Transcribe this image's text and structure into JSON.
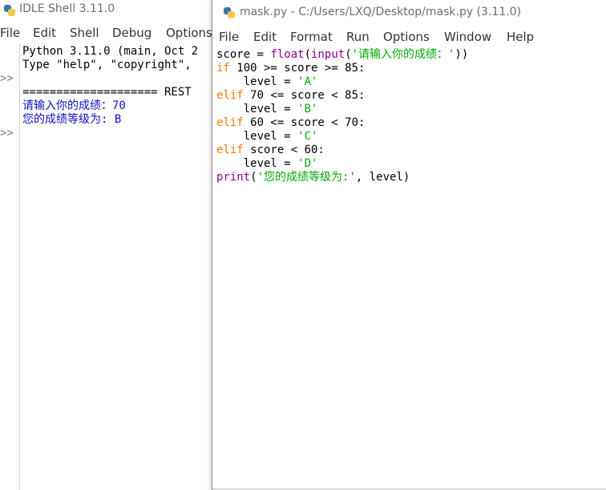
{
  "shell": {
    "title": "IDLE Shell 3.11.0",
    "menu": [
      "File",
      "Edit",
      "Shell",
      "Debug",
      "Options"
    ],
    "prompt": ">>",
    "lines": [
      {
        "text": "Python 3.11.0 (main, Oct 2",
        "cls": ""
      },
      {
        "text": "Type \"help\", \"copyright\",",
        "cls": ""
      },
      {
        "text": "",
        "cls": ""
      },
      {
        "text": "==================== REST",
        "cls": ""
      },
      {
        "text": "请输入你的成绩：70",
        "cls": "blue-out"
      },
      {
        "text": "您的成绩等级为: B",
        "cls": "blue-out"
      }
    ]
  },
  "editor": {
    "title": "mask.py - C:/Users/LXQ/Desktop/mask.py (3.11.0)",
    "menu": [
      "File",
      "Edit",
      "Format",
      "Run",
      "Options",
      "Window",
      "Help"
    ],
    "code": [
      [
        {
          "t": "score = ",
          "c": ""
        },
        {
          "t": "float",
          "c": "bi"
        },
        {
          "t": "(",
          "c": ""
        },
        {
          "t": "input",
          "c": "bi"
        },
        {
          "t": "(",
          "c": ""
        },
        {
          "t": "'请输入你的成绩：'",
          "c": "st"
        },
        {
          "t": "))",
          "c": ""
        }
      ],
      [
        {
          "t": "if",
          "c": "kw"
        },
        {
          "t": " 100 >= score >= 85:",
          "c": ""
        }
      ],
      [
        {
          "t": "    level = ",
          "c": ""
        },
        {
          "t": "'A'",
          "c": "st"
        }
      ],
      [
        {
          "t": "elif",
          "c": "kw"
        },
        {
          "t": " 70 <= score < 85:",
          "c": ""
        }
      ],
      [
        {
          "t": "    level = ",
          "c": ""
        },
        {
          "t": "'B'",
          "c": "st"
        }
      ],
      [
        {
          "t": "elif",
          "c": "kw"
        },
        {
          "t": " 60 <= score < 70:",
          "c": ""
        }
      ],
      [
        {
          "t": "    level = ",
          "c": ""
        },
        {
          "t": "'C'",
          "c": "st"
        }
      ],
      [
        {
          "t": "elif",
          "c": "kw"
        },
        {
          "t": " score < 60:",
          "c": ""
        }
      ],
      [
        {
          "t": "    level = ",
          "c": ""
        },
        {
          "t": "'D'",
          "c": "st"
        }
      ],
      [
        {
          "t": "print",
          "c": "bi"
        },
        {
          "t": "(",
          "c": ""
        },
        {
          "t": "'您的成绩等级为:'",
          "c": "st"
        },
        {
          "t": ", level)",
          "c": ""
        }
      ]
    ]
  },
  "colors": {
    "keyword": "#ff7700",
    "builtin": "#900090",
    "string": "#00aa00",
    "shell_output": "#1010c8"
  }
}
